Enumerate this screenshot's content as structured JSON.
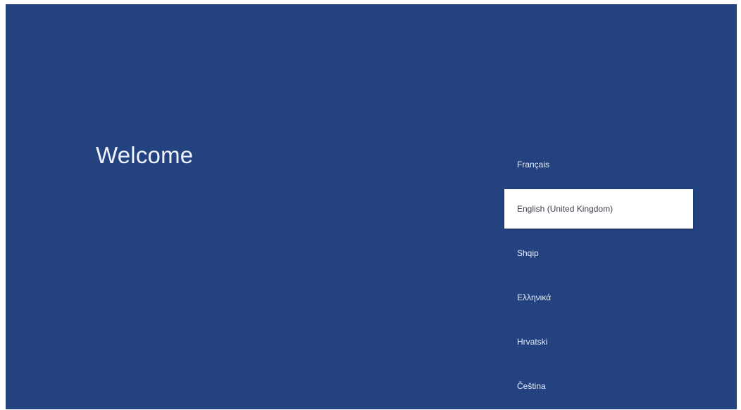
{
  "welcome": {
    "title": "Welcome"
  },
  "languages": {
    "selected_index": 1,
    "items": [
      {
        "label": "Français"
      },
      {
        "label": "English (United Kingdom)"
      },
      {
        "label": "Shqip"
      },
      {
        "label": "Ελληνικά"
      },
      {
        "label": "Hrvatski"
      },
      {
        "label": "Čeština"
      }
    ]
  },
  "colors": {
    "background": "#24427f",
    "selected_background": "#ffffff",
    "text": "#e6ecf8",
    "selected_text": "#3a3f4a"
  }
}
